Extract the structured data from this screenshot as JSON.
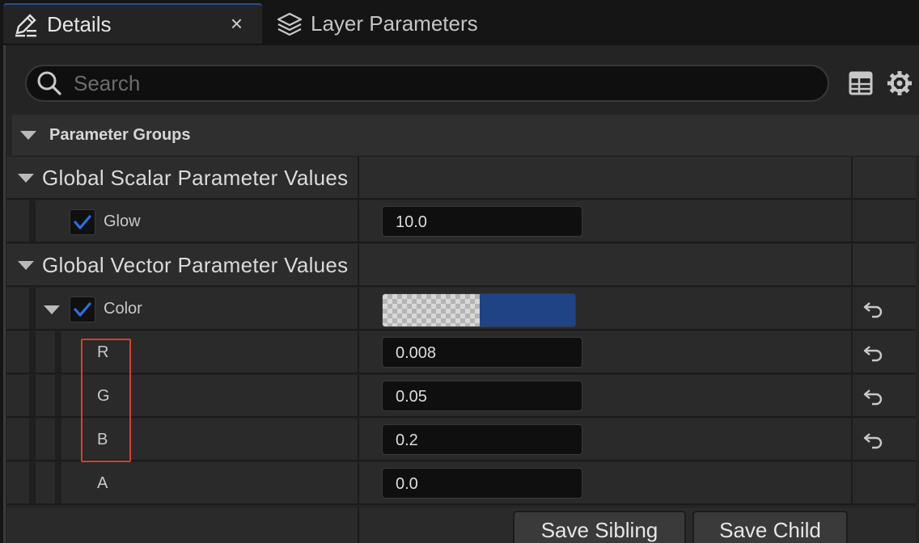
{
  "tabs": [
    {
      "label": "Details",
      "icon": "edit-icon",
      "active": true,
      "close": "×"
    },
    {
      "label": "Layer Parameters",
      "icon": "layers-icon",
      "active": false
    }
  ],
  "search": {
    "placeholder": "Search",
    "value": ""
  },
  "toolbar": {
    "table_icon": "table-view-icon",
    "settings_icon": "gear-icon"
  },
  "groups_header": "Parameter Groups",
  "categories": [
    {
      "label": "Global Scalar Parameter Values",
      "params": [
        {
          "name": "Glow",
          "enabled": true,
          "value": "10.0"
        }
      ]
    },
    {
      "label": "Global Vector Parameter Values",
      "params": [
        {
          "name": "Color",
          "enabled": true,
          "swatch_color": "#1f4385",
          "components": [
            {
              "name": "R",
              "value": "0.008",
              "resettable": true
            },
            {
              "name": "G",
              "value": "0.05",
              "resettable": true
            },
            {
              "name": "B",
              "value": "0.2",
              "resettable": true
            },
            {
              "name": "A",
              "value": "0.0",
              "resettable": false
            }
          ]
        }
      ]
    }
  ],
  "buttons": {
    "save_sibling": "Save Sibling",
    "save_child": "Save Child"
  },
  "colors": {
    "accent": "#2b6fe0",
    "highlight": "#d8402a",
    "panel": "#242424"
  }
}
